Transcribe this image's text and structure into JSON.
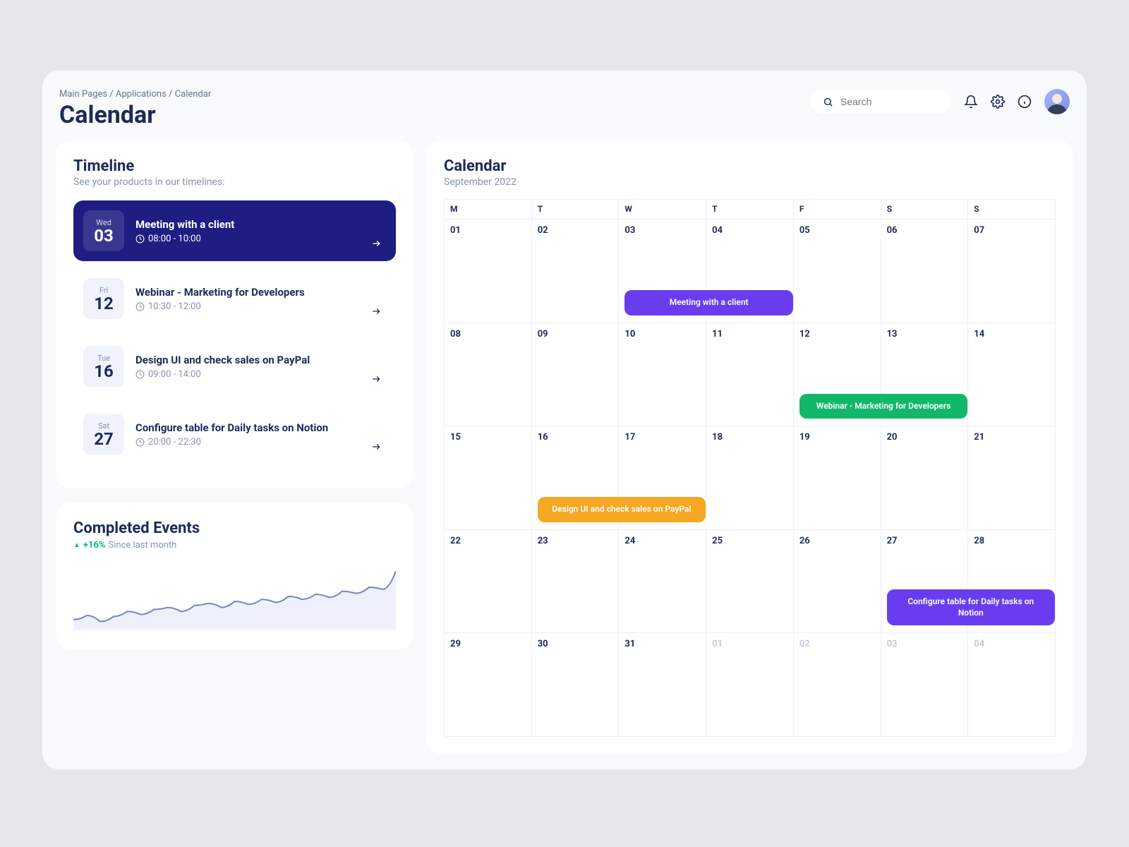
{
  "breadcrumb": "Main Pages / Applications / Calendar",
  "page_title": "Calendar",
  "search_placeholder": "Search",
  "sidebar": {
    "timeline_title": "Timeline",
    "timeline_sub": "See your products in our timelines:",
    "items": [
      {
        "dow": "Wed",
        "day": "03",
        "title": "Meeting with a client",
        "time": "08:00 - 10:00"
      },
      {
        "dow": "Fri",
        "day": "12",
        "title": "Webinar - Marketing for Developers",
        "time": "10:30 - 12:00"
      },
      {
        "dow": "Tue",
        "day": "16",
        "title": "Design UI and check sales on PayPal",
        "time": "09:00 - 14:00"
      },
      {
        "dow": "Sat",
        "day": "27",
        "title": "Configure table for Daily tasks on Notion",
        "time": "20:00 - 22:30"
      }
    ],
    "completed_title": "Completed Events",
    "completed_delta": "+16%",
    "completed_since": "Since last month"
  },
  "calendar": {
    "title": "Calendar",
    "month": "September 2022",
    "days_of_week": [
      "M",
      "T",
      "W",
      "T",
      "F",
      "S",
      "S"
    ],
    "weeks": [
      [
        "01",
        "02",
        "03",
        "04",
        "05",
        "06",
        "07"
      ],
      [
        "08",
        "09",
        "10",
        "11",
        "12",
        "13",
        "14"
      ],
      [
        "15",
        "16",
        "17",
        "18",
        "19",
        "20",
        "21"
      ],
      [
        "22",
        "23",
        "24",
        "25",
        "26",
        "27",
        "28"
      ],
      [
        "29",
        "30",
        "31",
        "01",
        "02",
        "03",
        "04"
      ]
    ],
    "events": {
      "w0c2": {
        "label": "Meeting with a client",
        "class": "ev-purple",
        "span": 2
      },
      "w1c4": {
        "label": "Webinar - Marketing for Developers",
        "class": "ev-green",
        "span": 2
      },
      "w2c1": {
        "label": "Design UI and check sales on PayPal",
        "class": "ev-orange",
        "span": 2
      },
      "w3c5": {
        "label": "Configure table for Daily tasks on Notion",
        "class": "ev-purple",
        "span": 2
      }
    }
  },
  "chart_data": {
    "type": "line",
    "title": "Completed Events",
    "x": [
      0,
      1,
      2,
      3,
      4,
      5,
      6,
      7,
      8,
      9,
      10,
      11,
      12,
      13,
      14,
      15,
      16,
      17,
      18,
      19,
      20,
      21,
      22,
      23,
      24
    ],
    "values": [
      30,
      34,
      28,
      33,
      38,
      35,
      40,
      42,
      38,
      44,
      46,
      42,
      48,
      45,
      50,
      47,
      53,
      50,
      55,
      52,
      58,
      56,
      62,
      60,
      78
    ],
    "ylim": [
      20,
      90
    ],
    "delta_label": "+16%",
    "series_color": "#7685c6",
    "fill_color": "#eef0fb"
  }
}
